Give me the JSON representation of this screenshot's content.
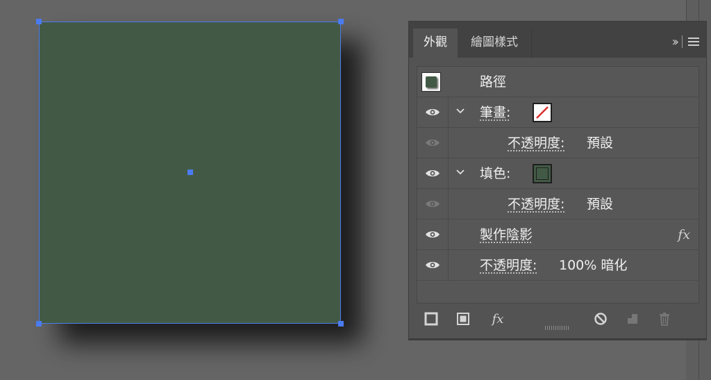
{
  "tabs": [
    {
      "label": "外觀",
      "active": true
    },
    {
      "label": "繪圖樣式",
      "active": false
    }
  ],
  "panel_controls": {
    "collapse_label": "››",
    "menu_icon": "hamburger-menu-icon"
  },
  "object": {
    "fill_color": "#425a45",
    "selection_color": "#4b7bf0"
  },
  "rows": {
    "path": {
      "label": "路徑"
    },
    "stroke": {
      "label": "筆畫:",
      "swatch": "none-slash"
    },
    "stroke_opacity": {
      "label": "不透明度:",
      "value": "預設"
    },
    "fill": {
      "label": "填色:",
      "swatch_color": "#425a45"
    },
    "fill_opacity": {
      "label": "不透明度:",
      "value": "預設"
    },
    "shadow": {
      "label": "製作陰影",
      "fx": "fx"
    },
    "opacity": {
      "label": "不透明度:",
      "value": "100% 暗化"
    }
  },
  "footer": {
    "fx_label": "fx",
    "buttons": [
      "add-new-stroke-icon",
      "add-new-fill-icon",
      "add-new-effect-icon",
      "clear-appearance-icon",
      "duplicate-item-icon",
      "delete-item-icon"
    ]
  }
}
